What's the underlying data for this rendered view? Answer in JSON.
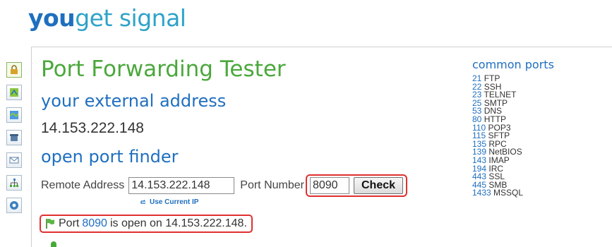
{
  "logo": {
    "part1": "you",
    "part2": "get signal"
  },
  "tabs": [
    {
      "icon": "lock-icon"
    },
    {
      "icon": "map-icon"
    },
    {
      "icon": "globe-map-icon"
    },
    {
      "icon": "phone-icon"
    },
    {
      "icon": "mail-icon"
    },
    {
      "icon": "network-icon"
    },
    {
      "icon": "help-icon"
    }
  ],
  "main": {
    "title": "Port Forwarding Tester",
    "external_heading": "your external address",
    "external_ip": "14.153.222.148",
    "finder_heading": "open port finder",
    "remote_label": "Remote Address",
    "remote_value": "14.153.222.148",
    "port_label": "Port Number",
    "port_value": "8090",
    "check_label": "Check",
    "use_current_ip": "Use Current IP",
    "result": {
      "prefix": "Port",
      "port": "8090",
      "suffix": "is open on 14.153.222.148."
    }
  },
  "common_ports": {
    "title": "common ports",
    "items": [
      {
        "port": "21",
        "service": "FTP"
      },
      {
        "port": "22",
        "service": "SSH"
      },
      {
        "port": "23",
        "service": "TELNET"
      },
      {
        "port": "25",
        "service": "SMTP"
      },
      {
        "port": "53",
        "service": "DNS"
      },
      {
        "port": "80",
        "service": "HTTP"
      },
      {
        "port": "110",
        "service": "POP3"
      },
      {
        "port": "115",
        "service": "SFTP"
      },
      {
        "port": "135",
        "service": "RPC"
      },
      {
        "port": "139",
        "service": "NetBIOS"
      },
      {
        "port": "143",
        "service": "IMAP"
      },
      {
        "port": "194",
        "service": "IRC"
      },
      {
        "port": "443",
        "service": "SSL"
      },
      {
        "port": "445",
        "service": "SMB"
      },
      {
        "port": "1433",
        "service": "MSSQL"
      }
    ]
  },
  "colors": {
    "title_green": "#4aa83b",
    "heading_blue": "#1f6fbf",
    "highlight_red": "#e03030"
  }
}
